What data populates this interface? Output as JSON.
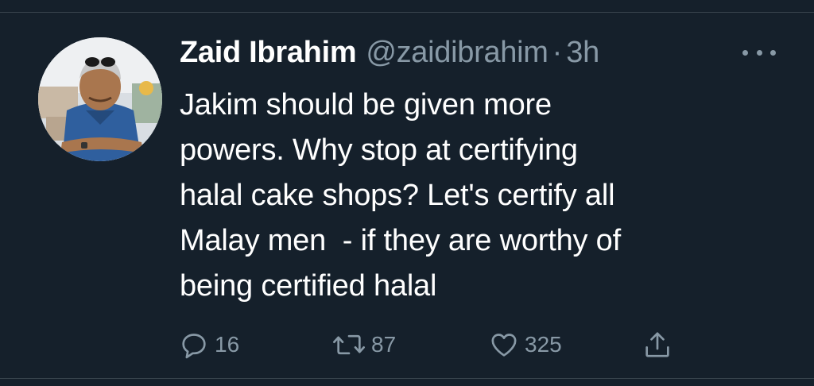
{
  "tweet": {
    "author_name": "Zaid Ibrahim",
    "author_handle": "@zaidibrahim",
    "separator": "·",
    "timestamp": "3h",
    "text": "Jakim should be given more\npowers. Why stop at certifying\nhalal cake shops? Let's certify all\nMalay men  - if they are worthy of\nbeing certified halal",
    "actions": {
      "reply_count": "16",
      "retweet_count": "87",
      "like_count": "325"
    }
  },
  "colors": {
    "background": "#15202b",
    "primary_text": "#ffffff",
    "secondary_text": "#8899a6",
    "divider": "#38444d"
  },
  "icons": {
    "more": "more-dots-icon",
    "reply": "reply-bubble-icon",
    "retweet": "retweet-arrows-icon",
    "like": "heart-icon",
    "share": "share-upload-icon"
  }
}
